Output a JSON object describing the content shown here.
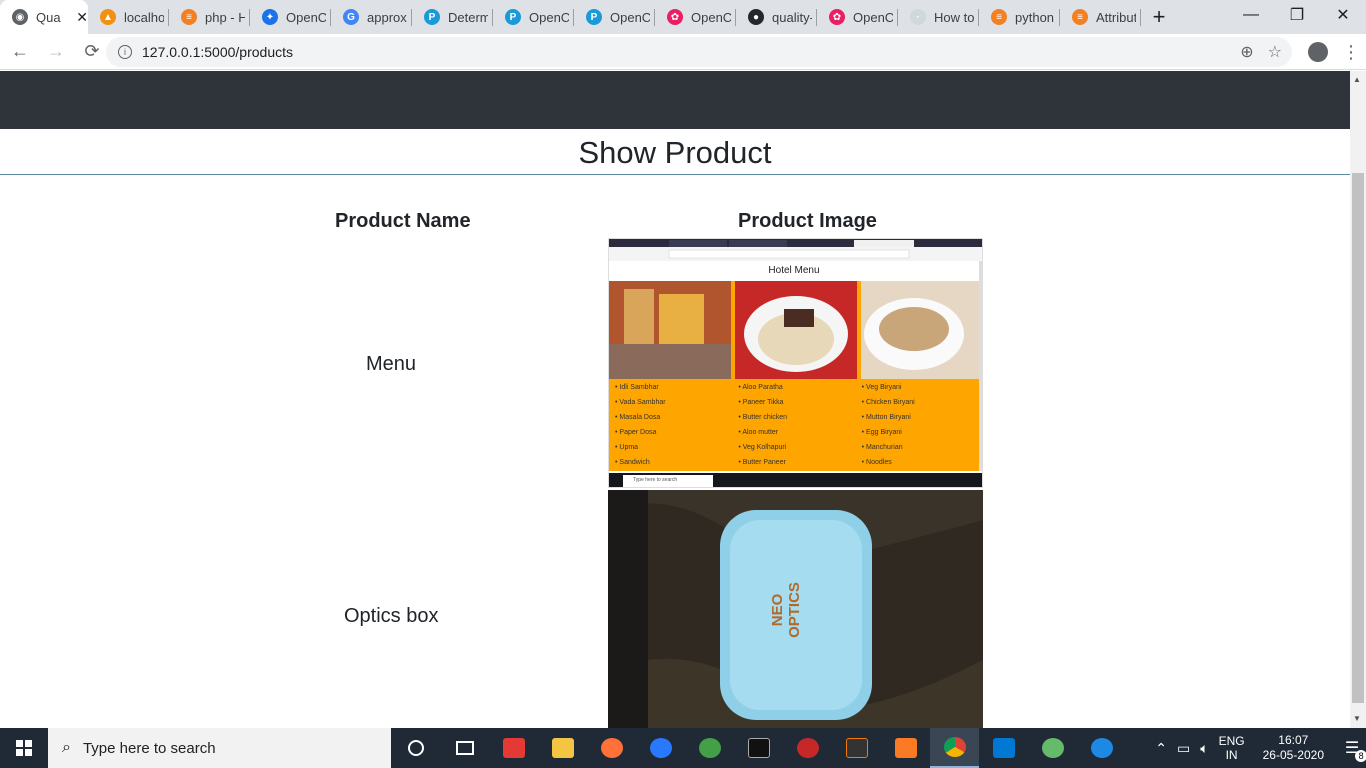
{
  "browser": {
    "tabs": [
      {
        "title": "Qua",
        "color": "#5f6368",
        "glyph": "◉"
      },
      {
        "title": "localho",
        "color": "#f29111",
        "glyph": "▲"
      },
      {
        "title": "php - H",
        "color": "#f48024",
        "glyph": "≡"
      },
      {
        "title": "OpenCV",
        "color": "#1a73e8",
        "glyph": "✦"
      },
      {
        "title": "approxi",
        "color": "#4285f4",
        "glyph": "G"
      },
      {
        "title": "Determ",
        "color": "#1a9ad6",
        "glyph": "P"
      },
      {
        "title": "OpenCV",
        "color": "#1a9ad6",
        "glyph": "P"
      },
      {
        "title": "OpenCV",
        "color": "#1a9ad6",
        "glyph": "P"
      },
      {
        "title": "OpenCV",
        "color": "#e91e63",
        "glyph": "✿"
      },
      {
        "title": "quality-",
        "color": "#24292e",
        "glyph": "●"
      },
      {
        "title": "OpenCV",
        "color": "#e91e63",
        "glyph": "✿"
      },
      {
        "title": "How to",
        "color": "#cfd8dc",
        "glyph": "·"
      },
      {
        "title": "python",
        "color": "#f48024",
        "glyph": "≡"
      },
      {
        "title": "Attribut",
        "color": "#f48024",
        "glyph": "≡"
      }
    ],
    "url": "127.0.0.1:5000/products",
    "new_tab": "+",
    "window_controls": [
      "—",
      "❐",
      "✕"
    ]
  },
  "page": {
    "heading": "Show Product",
    "columns": {
      "name": "Product Name",
      "image": "Product Image"
    },
    "products": [
      {
        "name": "Menu"
      },
      {
        "name": "Optics box"
      }
    ],
    "menu_image": {
      "title": "Hotel Menu",
      "columns": [
        [
          "Idli Sambhar",
          "Vada Sambhar",
          "Masala Dosa",
          "Paper Dosa",
          "Upma",
          "Sandwich"
        ],
        [
          "Aloo Paratha",
          "Paneer Tikka",
          "Butter chicken",
          "Aloo mutter",
          "Veg Kolhapuri",
          "Butter Paneer"
        ],
        [
          "Veg Biryani",
          "Chicken Biryani",
          "Mutton Biryani",
          "Egg Biryani",
          "Manchurian",
          "Noodles"
        ]
      ],
      "search_text": "Type here to search"
    },
    "box_image": {
      "brand": "NEO OPTICS"
    }
  },
  "taskbar": {
    "search_placeholder": "Type here to search",
    "lang": [
      "ENG",
      "IN"
    ],
    "time": "16:07",
    "date": "26-05-2020",
    "notifications": "8"
  }
}
